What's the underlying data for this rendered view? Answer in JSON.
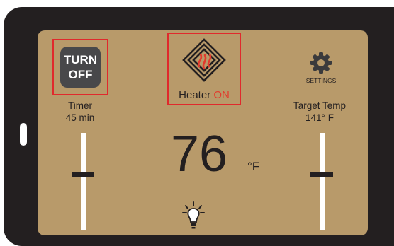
{
  "timer": {
    "turn_off_line1": "TURN",
    "turn_off_line2": "OFF",
    "label": "Timer",
    "value": "45 min",
    "slider_level": 0.57
  },
  "heater": {
    "label": "Heater",
    "status": "ON",
    "status_color": "#e2392c",
    "icon": "heater-flame-icon"
  },
  "settings": {
    "label": "SETTINGS",
    "icon": "gear-icon"
  },
  "target": {
    "label": "Target Temp",
    "value": "141° F",
    "slider_level": 0.57
  },
  "current": {
    "value": "76",
    "unit": "°F"
  },
  "light": {
    "icon": "light-bulb-icon"
  },
  "colors": {
    "screen": "#b89a6a",
    "device": "#231f20",
    "highlight": "#e0292c"
  }
}
